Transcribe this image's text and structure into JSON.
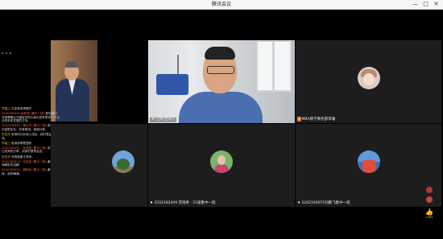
{
  "window": {
    "title": "腾讯会议",
    "controls": [
      "—",
      "□",
      "✕"
    ]
  },
  "tiles": {
    "main": {
      "name": "王辉·主持人"
    },
    "right_top": {
      "badge": "2",
      "name": "MBA教学事务部李珊"
    },
    "center_bottom": {
      "name": "2202182009 李雨希 · 21级集中一班"
    },
    "right_bottom": {
      "name": "2202100055刘鹏飞集中一班"
    }
  },
  "chat": [
    {
      "who": "李福工:",
      "text": "王老师讲得很好",
      "hl": false
    },
    {
      "who": "2202182020 赵轩浩 (集中一班):",
      "text": "现在我们非常需要从中国经济的大局出发来思考一个企业的未来发展的方向。",
      "hl": true
    },
    {
      "who": "2202100033 - 杨立华 (集中一班):",
      "text": "老师讲的内容很实在，非常受用，谢谢分享。",
      "hl": true
    },
    {
      "who": "张宏亮:",
      "text": "老师的分析深入浅出，我们受益匪浅。",
      "hl": false
    },
    {
      "who": "李福工:",
      "text": "老师讲得很透彻",
      "hl": false
    },
    {
      "who": "2202182052 - 孙浩然 (集中一班):",
      "text": "非常感谢王老师的分享，对我们很有启发。",
      "hl": true
    },
    {
      "who": "张宏亮:",
      "text": "非常感谢王老师。",
      "hl": false
    },
    {
      "who": "2202182013 - 吕佳佳 (集中一班):",
      "text": "谢谢王老师精彩的讲解。",
      "hl": true
    },
    {
      "who": "2202182021 - 程雨欣 (集中一班):",
      "text": "谢谢老师，收获满满。",
      "hl": true
    }
  ],
  "like_count": "2565",
  "colors": {
    "accent": "#e0781a",
    "chat_name": "#e7a23b",
    "chat_name_highlight": "#ff6a3d"
  }
}
